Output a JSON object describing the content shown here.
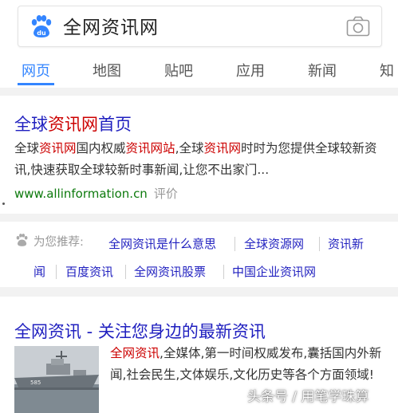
{
  "search": {
    "query": "全网资讯网"
  },
  "tabs": [
    {
      "label": "网页",
      "active": true
    },
    {
      "label": "地图"
    },
    {
      "label": "贴吧"
    },
    {
      "label": "应用"
    },
    {
      "label": "新闻"
    },
    {
      "label": "知"
    }
  ],
  "result1": {
    "title_a": "全球",
    "title_hl": "资讯网",
    "title_b": "首页",
    "abstract": [
      {
        "t": "全球",
        "hl": false
      },
      {
        "t": "资讯网",
        "hl": true
      },
      {
        "t": "国内权威",
        "hl": false
      },
      {
        "t": "资讯网站",
        "hl": true
      },
      {
        "t": ",全球",
        "hl": false
      },
      {
        "t": "资讯网",
        "hl": true
      },
      {
        "t": "时时为您提供全球较新资讯,快速获取全球较新时事新闻,让您不出家门...",
        "hl": false
      }
    ],
    "url": "www.allinformation.cn",
    "review": "评价"
  },
  "recommend": {
    "label": "为您推荐:",
    "items": [
      "全网资讯是什么意思",
      "全球资源网",
      "资讯新",
      "闻",
      "百度资讯",
      "全网资讯股票",
      "中国企业资讯网"
    ]
  },
  "result2": {
    "title": "全网资讯 - 关注您身边的最新资讯",
    "abstract": [
      {
        "t": "全网资讯",
        "hl": true
      },
      {
        "t": ",全媒体,第一时间权威发布,囊括国内外新闻,社会民生,文体娱乐,文化历史等各个方面领域!",
        "hl": false
      }
    ]
  },
  "watermark": "头条号 / 用笔学珠算",
  "colors": {
    "link": "#1f1fbf",
    "highlight": "#cc0000",
    "url": "#0d7a0d",
    "accent": "#3385ff"
  },
  "icons": {
    "logo": "paw-icon",
    "camera": "camera-icon",
    "recommend": "paw-icon"
  }
}
